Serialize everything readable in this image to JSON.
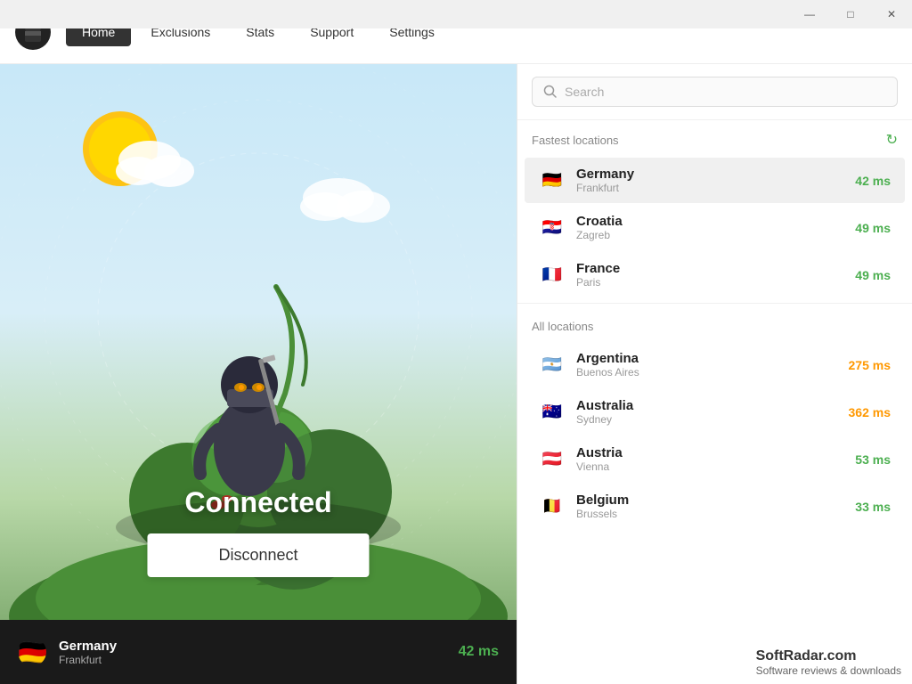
{
  "window": {
    "min_label": "—",
    "max_label": "□",
    "close_label": "✕"
  },
  "navbar": {
    "tabs": [
      {
        "label": "Home",
        "active": true
      },
      {
        "label": "Exclusions",
        "active": false
      },
      {
        "label": "Stats",
        "active": false
      },
      {
        "label": "Support",
        "active": false
      },
      {
        "label": "Settings",
        "active": false
      }
    ]
  },
  "left_panel": {
    "status_text": "Connected",
    "disconnect_label": "Disconnect",
    "status_bar": {
      "country": "Germany",
      "city": "Frankfurt",
      "ms": "42 ms"
    }
  },
  "right_panel": {
    "search_placeholder": "Search",
    "fastest_section": "Fastest locations",
    "all_section": "All locations",
    "locations_fastest": [
      {
        "country": "Germany",
        "city": "Frankfurt",
        "ms": "42 ms",
        "ms_class": "ms-green",
        "flag": "🇩🇪",
        "selected": true
      },
      {
        "country": "Croatia",
        "city": "Zagreb",
        "ms": "49 ms",
        "ms_class": "ms-green",
        "flag": "🇭🇷",
        "selected": false
      },
      {
        "country": "France",
        "city": "Paris",
        "ms": "49 ms",
        "ms_class": "ms-green",
        "flag": "🇫🇷",
        "selected": false
      }
    ],
    "locations_all": [
      {
        "country": "Argentina",
        "city": "Buenos Aires",
        "ms": "275 ms",
        "ms_class": "ms-orange",
        "flag": "🇦🇷",
        "selected": false
      },
      {
        "country": "Australia",
        "city": "Sydney",
        "ms": "362 ms",
        "ms_class": "ms-orange",
        "flag": "🇦🇺",
        "selected": false
      },
      {
        "country": "Austria",
        "city": "Vienna",
        "ms": "53 ms",
        "ms_class": "ms-green",
        "flag": "🇦🇹",
        "selected": false
      },
      {
        "country": "Belgium",
        "city": "Brussels",
        "ms": "33 ms",
        "ms_class": "ms-green",
        "flag": "🇧🇪",
        "selected": false
      }
    ]
  },
  "watermark": {
    "site": "SoftRadar.com",
    "sub": "Software reviews & downloads"
  }
}
